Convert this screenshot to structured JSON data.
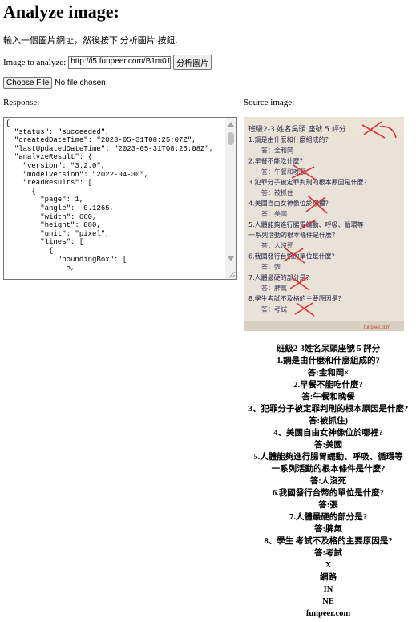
{
  "page": {
    "title": "Analyze image:",
    "intro": "輸入一個圖片網址，然後按下 分析圖片 按鈕."
  },
  "analyze": {
    "label": "Image to analyze:",
    "url_value": "http://i5.funpeer.com/B1m01",
    "button_label": "分析圖片"
  },
  "file": {
    "button_label": "Choose File",
    "status": "No file chosen"
  },
  "labels": {
    "response": "Response:",
    "source": "Source image:"
  },
  "response_json": "{\n  \"status\": \"succeeded\",\n  \"createdDateTime\": \"2023-05-31T08:25:07Z\",\n  \"lastUpdatedDateTime\": \"2023-05-31T08:25:08Z\",\n  \"analyzeResult\": {\n    \"version\": \"3.2.0\",\n    \"modelVersion\": \"2022-04-30\",\n    \"readResults\": [\n      {\n        \"page\": 1,\n        \"angle\": -0.1265,\n        \"width\": 660,\n        \"height\": 880,\n        \"unit\": \"pixel\",\n        \"lines\": [\n          {\n            \"boundingBox\": [\n              5,",
  "photo": {
    "lines": [
      "班級2-3 姓名吳頭 座號 5 評分",
      "1.鋼是由什麼和什麼組成的？",
      "答：金和岡",
      "2.早餐不能吃什麼？",
      "答：午餐和晚餐",
      "3.犯罪分子被定罪判刑的根本原因是什麼？",
      "答：被抓住",
      "4.美國自由女神像位於哪裡？",
      "答：美國",
      "5.人體能夠進行腸胃蠕動、呼吸、循環等",
      "一系列活動的根本條件是什麼？",
      "答：人沒死",
      "6.我國發行台幣的單位是什麼？",
      "答：張",
      "7.人體最硬的部分是？",
      "答：脾氣",
      "8.學生考試不及格的主要原因是？",
      "答：考試"
    ],
    "watermark": "funpeer.com"
  },
  "ocr_lines": [
    "班級2-3姓名呆頭座號 5 評分",
    "1.鋼是由什麼和什麼組成的?",
    "答:金和岡×",
    "2.早餐不能吃什麼?",
    "答:午餐和晚餐",
    "3、犯罪分子被定罪判刑的根本原因是什麼?",
    "答:被抓住)",
    "4、美國自由女神像位於哪裡?",
    "答:美國",
    "5.人體能夠進行腸胃蠕動、呼吸、循環等",
    "一系列活動的根本條件是什麼?",
    "答:人沒死",
    "6.我國發行台幣的單位是什麼?",
    "答:張",
    "7.人體最硬的部分是?",
    "答:脾氣",
    "8、學生 考試不及格的主要原因是?",
    "答:考試",
    "X",
    "網路",
    "IN",
    "NE",
    "funpeer.com"
  ]
}
